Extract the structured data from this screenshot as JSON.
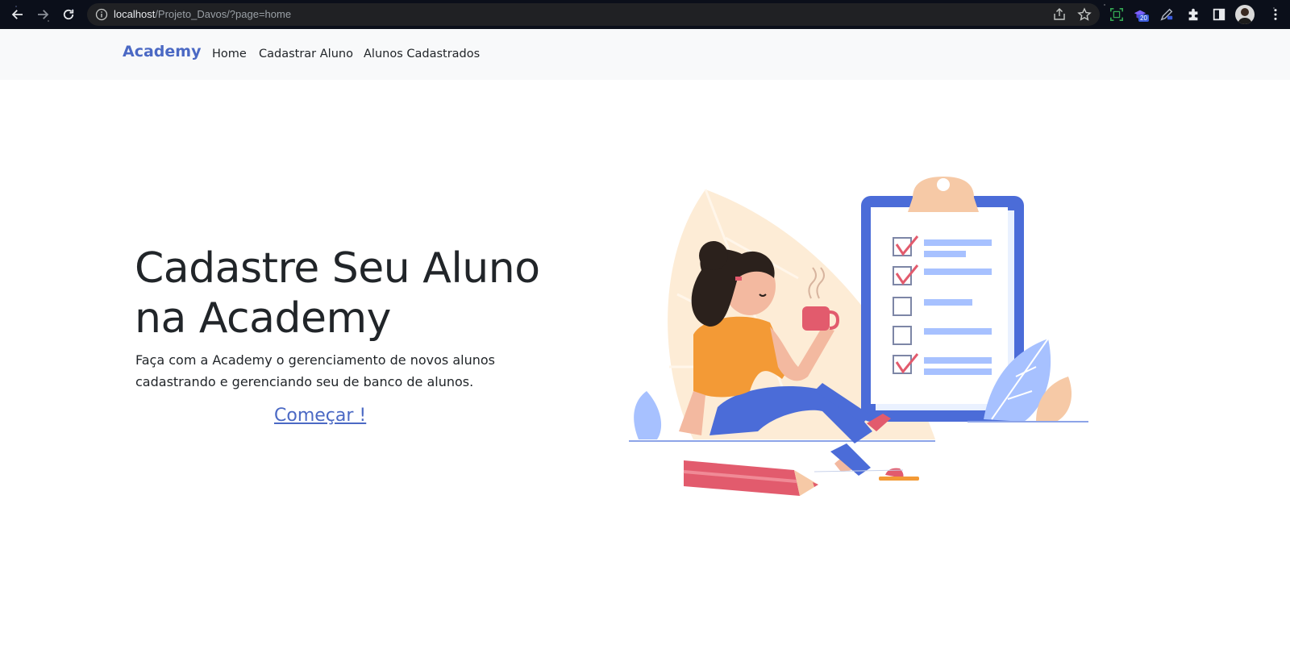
{
  "browser": {
    "url_host": "localhost",
    "url_path": "/Projeto_Davos/?page=home",
    "extension_badge": "20"
  },
  "navbar": {
    "brand": "Academy",
    "links": [
      {
        "label": "Home"
      },
      {
        "label": "Cadastrar Aluno"
      },
      {
        "label": "Alunos Cadastrados"
      }
    ]
  },
  "hero": {
    "title": "Cadastre Seu Aluno na Academy",
    "subtitle": "Faça com a Academy o gerenciamento de novos alunos cadastrando e gerenciando seu de banco de alunos.",
    "cta": "Começar !"
  },
  "colors": {
    "brand": "#4b69c4",
    "navbar_bg": "#f8f9fa",
    "text": "#212529"
  },
  "icons": [
    "back-arrow-icon",
    "forward-arrow-icon",
    "reload-icon",
    "info-icon",
    "share-icon",
    "star-icon",
    "screenshot-icon",
    "extension-icon",
    "pen-icon",
    "puzzle-icon",
    "sidebar-icon",
    "avatar",
    "kebab-menu-icon"
  ]
}
